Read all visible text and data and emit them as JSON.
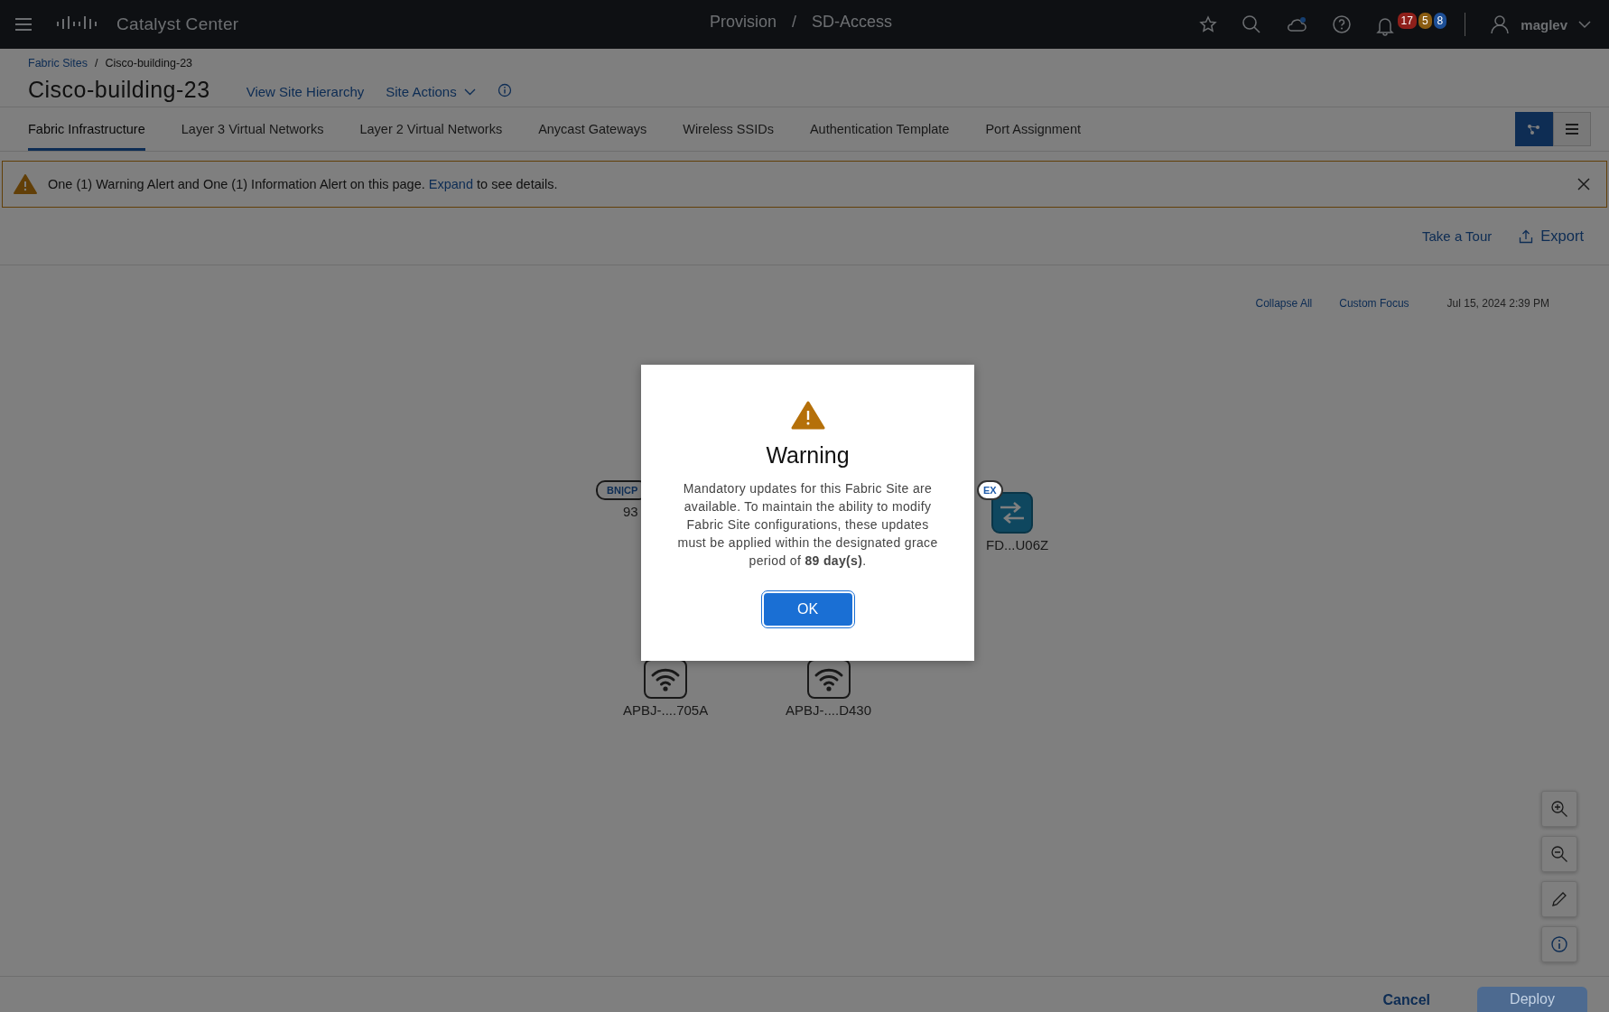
{
  "top_bar": {
    "app_name": "Catalyst Center",
    "path": [
      "Provision",
      "SD-Access"
    ],
    "path_separator": "/",
    "notification_counts": [
      {
        "count": "17",
        "color": "#8e1f1a"
      },
      {
        "count": "5",
        "color": "#8a5c12"
      },
      {
        "count": "8",
        "color": "#1d4f96"
      }
    ],
    "user": "maglev"
  },
  "breadcrumb": {
    "items": [
      "Fabric Sites",
      "Cisco-building-23"
    ],
    "separator": "/"
  },
  "page_title": "Cisco-building-23",
  "header_links": [
    {
      "label": "View Site Hierarchy",
      "dropdown": false
    },
    {
      "label": "Site Actions",
      "dropdown": true
    }
  ],
  "tabs": [
    {
      "label": "Fabric Infrastructure",
      "selected": true
    },
    {
      "label": "Layer 3 Virtual Networks",
      "selected": false
    },
    {
      "label": "Layer 2 Virtual Networks",
      "selected": false
    },
    {
      "label": "Anycast Gateways",
      "selected": false
    },
    {
      "label": "Wireless SSIDs",
      "selected": false
    },
    {
      "label": "Authentication Template",
      "selected": false
    },
    {
      "label": "Port Assignment",
      "selected": false
    }
  ],
  "view_toggle": [
    {
      "kind": "topology",
      "selected": true
    },
    {
      "kind": "list",
      "selected": false
    }
  ],
  "alert": {
    "text_before": "One (1) Warning Alert and One (1) Information Alert on this page.",
    "link": "Expand",
    "text_after": "to see details."
  },
  "toolbar": {
    "tour": "Take a Tour",
    "export": "Export"
  },
  "canvas": {
    "collapse_all": "Collapse All",
    "custom_focus": "Custom Focus",
    "timestamp": "Jul 15, 2024 2:39 PM",
    "nodes": [
      {
        "kind": "badge_only",
        "badge": "BN|CP",
        "label": "93"
      },
      {
        "kind": "switch",
        "badge": "EX",
        "label": "FD...U06Z"
      },
      {
        "kind": "ap",
        "label": "APBJ-....705A"
      },
      {
        "kind": "ap",
        "label": "APBJ-....D430"
      }
    ]
  },
  "footer": {
    "cancel": "Cancel",
    "deploy": {
      "label": "Deploy",
      "disabled": true
    }
  },
  "modal": {
    "title": "Warning",
    "message": "Mandatory updates for this Fabric Site are available. To maintain the ability to modify Fabric Site configurations, these updates must be applied within the designated grace period of **89 day(s)**.",
    "button": "OK"
  }
}
